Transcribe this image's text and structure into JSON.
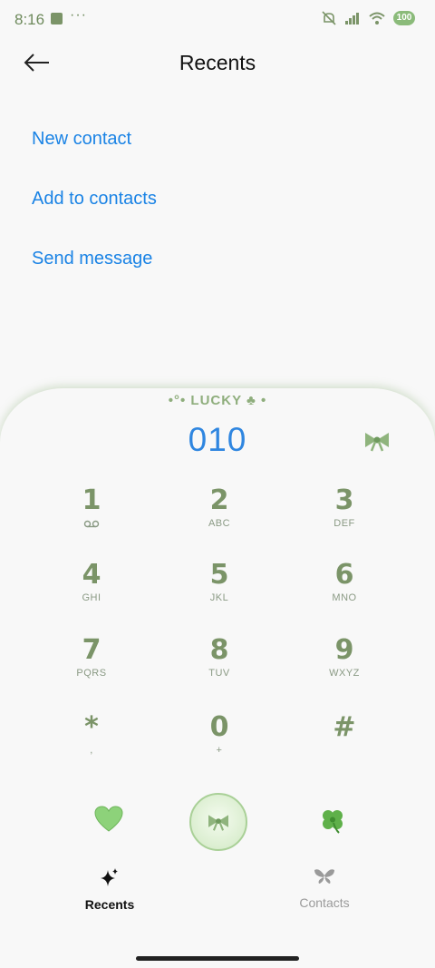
{
  "status": {
    "time": "8:16",
    "dots": "···",
    "battery": "100"
  },
  "header": {
    "title": "Recents"
  },
  "actions": [
    "New contact",
    "Add to contacts",
    "Send message"
  ],
  "dialer": {
    "theme_label": "LUCKY",
    "number": "010",
    "keys": [
      {
        "digit": "1",
        "letters": ""
      },
      {
        "digit": "2",
        "letters": "ABC"
      },
      {
        "digit": "3",
        "letters": "DEF"
      },
      {
        "digit": "4",
        "letters": "GHI"
      },
      {
        "digit": "5",
        "letters": "JKL"
      },
      {
        "digit": "6",
        "letters": "MNO"
      },
      {
        "digit": "7",
        "letters": "PQRS"
      },
      {
        "digit": "8",
        "letters": "TUV"
      },
      {
        "digit": "9",
        "letters": "WXYZ"
      },
      {
        "digit": "*",
        "letters": ","
      },
      {
        "digit": "0",
        "letters": "+"
      },
      {
        "digit": "#",
        "letters": ""
      }
    ]
  },
  "tabs": [
    {
      "label": "Recents",
      "icon": "sparkle-icon",
      "active": true
    },
    {
      "label": "Contacts",
      "icon": "butterfly-icon",
      "active": false
    }
  ],
  "colors": {
    "accent": "#1a83e5",
    "theme_green": "#7b9468",
    "number_blue": "#2f86e0"
  }
}
